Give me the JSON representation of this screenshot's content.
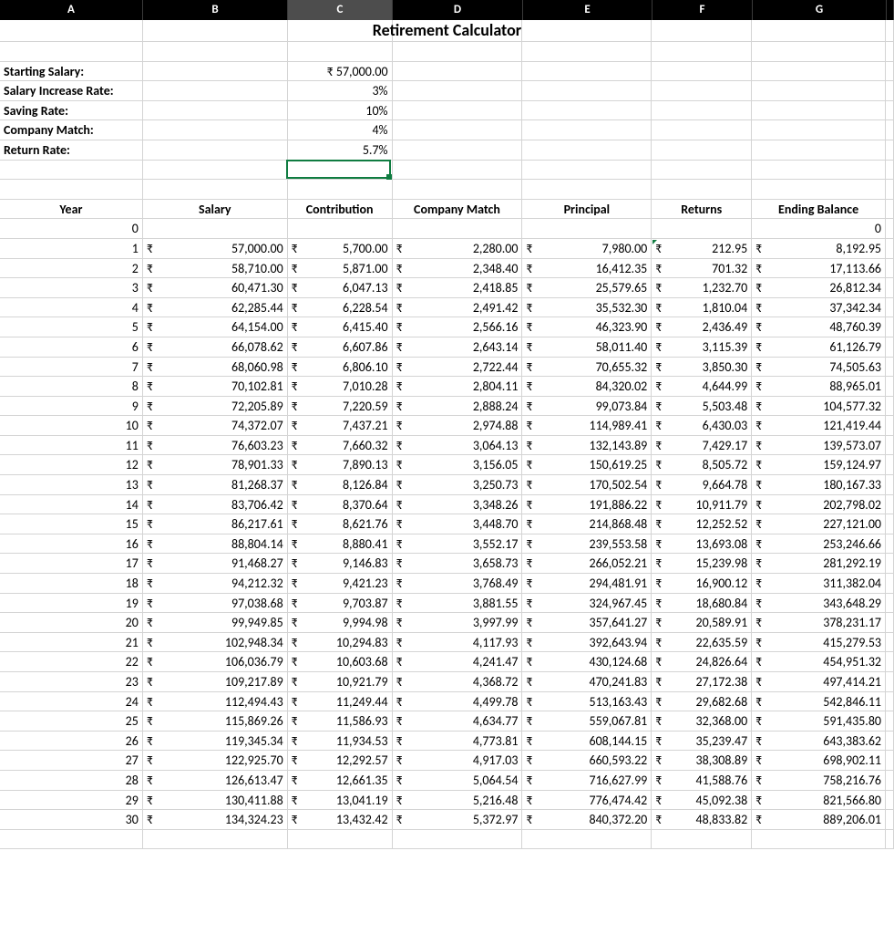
{
  "columns": [
    "A",
    "B",
    "C",
    "D",
    "E",
    "F",
    "G"
  ],
  "selected_column": "C",
  "selected_cell": {
    "row": 7,
    "col": 2
  },
  "title": "Retirement Calculator",
  "currency": "₹",
  "params": [
    {
      "label": "Starting Salary:",
      "value": "₹   57,000.00"
    },
    {
      "label": "Salary Increase Rate:",
      "value": "3%"
    },
    {
      "label": "Saving Rate:",
      "value": "10%"
    },
    {
      "label": "Company Match:",
      "value": "4%"
    },
    {
      "label": "Return Rate:",
      "value": "5.7%"
    }
  ],
  "table_headers": [
    "Year",
    "Salary",
    "Contribution",
    "Company Match",
    "Principal",
    "Returns",
    "Ending Balance"
  ],
  "rows": [
    {
      "year": "0",
      "salary": "",
      "contribution": "",
      "company_match": "",
      "principal": "",
      "returns": "",
      "ending": "0",
      "ending_plain": true
    },
    {
      "year": "1",
      "salary": "57,000.00",
      "contribution": "5,700.00",
      "company_match": "2,280.00",
      "principal": "7,980.00",
      "returns": "212.95",
      "ending": "8,192.95",
      "returns_tri": true
    },
    {
      "year": "2",
      "salary": "58,710.00",
      "contribution": "5,871.00",
      "company_match": "2,348.40",
      "principal": "16,412.35",
      "returns": "701.32",
      "ending": "17,113.66"
    },
    {
      "year": "3",
      "salary": "60,471.30",
      "contribution": "6,047.13",
      "company_match": "2,418.85",
      "principal": "25,579.65",
      "returns": "1,232.70",
      "ending": "26,812.34"
    },
    {
      "year": "4",
      "salary": "62,285.44",
      "contribution": "6,228.54",
      "company_match": "2,491.42",
      "principal": "35,532.30",
      "returns": "1,810.04",
      "ending": "37,342.34"
    },
    {
      "year": "5",
      "salary": "64,154.00",
      "contribution": "6,415.40",
      "company_match": "2,566.16",
      "principal": "46,323.90",
      "returns": "2,436.49",
      "ending": "48,760.39"
    },
    {
      "year": "6",
      "salary": "66,078.62",
      "contribution": "6,607.86",
      "company_match": "2,643.14",
      "principal": "58,011.40",
      "returns": "3,115.39",
      "ending": "61,126.79"
    },
    {
      "year": "7",
      "salary": "68,060.98",
      "contribution": "6,806.10",
      "company_match": "2,722.44",
      "principal": "70,655.32",
      "returns": "3,850.30",
      "ending": "74,505.63"
    },
    {
      "year": "8",
      "salary": "70,102.81",
      "contribution": "7,010.28",
      "company_match": "2,804.11",
      "principal": "84,320.02",
      "returns": "4,644.99",
      "ending": "88,965.01"
    },
    {
      "year": "9",
      "salary": "72,205.89",
      "contribution": "7,220.59",
      "company_match": "2,888.24",
      "principal": "99,073.84",
      "returns": "5,503.48",
      "ending": "104,577.32"
    },
    {
      "year": "10",
      "salary": "74,372.07",
      "contribution": "7,437.21",
      "company_match": "2,974.88",
      "principal": "114,989.41",
      "returns": "6,430.03",
      "ending": "121,419.44"
    },
    {
      "year": "11",
      "salary": "76,603.23",
      "contribution": "7,660.32",
      "company_match": "3,064.13",
      "principal": "132,143.89",
      "returns": "7,429.17",
      "ending": "139,573.07"
    },
    {
      "year": "12",
      "salary": "78,901.33",
      "contribution": "7,890.13",
      "company_match": "3,156.05",
      "principal": "150,619.25",
      "returns": "8,505.72",
      "ending": "159,124.97"
    },
    {
      "year": "13",
      "salary": "81,268.37",
      "contribution": "8,126.84",
      "company_match": "3,250.73",
      "principal": "170,502.54",
      "returns": "9,664.78",
      "ending": "180,167.33"
    },
    {
      "year": "14",
      "salary": "83,706.42",
      "contribution": "8,370.64",
      "company_match": "3,348.26",
      "principal": "191,886.22",
      "returns": "10,911.79",
      "ending": "202,798.02"
    },
    {
      "year": "15",
      "salary": "86,217.61",
      "contribution": "8,621.76",
      "company_match": "3,448.70",
      "principal": "214,868.48",
      "returns": "12,252.52",
      "ending": "227,121.00"
    },
    {
      "year": "16",
      "salary": "88,804.14",
      "contribution": "8,880.41",
      "company_match": "3,552.17",
      "principal": "239,553.58",
      "returns": "13,693.08",
      "ending": "253,246.66"
    },
    {
      "year": "17",
      "salary": "91,468.27",
      "contribution": "9,146.83",
      "company_match": "3,658.73",
      "principal": "266,052.21",
      "returns": "15,239.98",
      "ending": "281,292.19"
    },
    {
      "year": "18",
      "salary": "94,212.32",
      "contribution": "9,421.23",
      "company_match": "3,768.49",
      "principal": "294,481.91",
      "returns": "16,900.12",
      "ending": "311,382.04"
    },
    {
      "year": "19",
      "salary": "97,038.68",
      "contribution": "9,703.87",
      "company_match": "3,881.55",
      "principal": "324,967.45",
      "returns": "18,680.84",
      "ending": "343,648.29"
    },
    {
      "year": "20",
      "salary": "99,949.85",
      "contribution": "9,994.98",
      "company_match": "3,997.99",
      "principal": "357,641.27",
      "returns": "20,589.91",
      "ending": "378,231.17"
    },
    {
      "year": "21",
      "salary": "102,948.34",
      "contribution": "10,294.83",
      "company_match": "4,117.93",
      "principal": "392,643.94",
      "returns": "22,635.59",
      "ending": "415,279.53"
    },
    {
      "year": "22",
      "salary": "106,036.79",
      "contribution": "10,603.68",
      "company_match": "4,241.47",
      "principal": "430,124.68",
      "returns": "24,826.64",
      "ending": "454,951.32"
    },
    {
      "year": "23",
      "salary": "109,217.89",
      "contribution": "10,921.79",
      "company_match": "4,368.72",
      "principal": "470,241.83",
      "returns": "27,172.38",
      "ending": "497,414.21"
    },
    {
      "year": "24",
      "salary": "112,494.43",
      "contribution": "11,249.44",
      "company_match": "4,499.78",
      "principal": "513,163.43",
      "returns": "29,682.68",
      "ending": "542,846.11"
    },
    {
      "year": "25",
      "salary": "115,869.26",
      "contribution": "11,586.93",
      "company_match": "4,634.77",
      "principal": "559,067.81",
      "returns": "32,368.00",
      "ending": "591,435.80"
    },
    {
      "year": "26",
      "salary": "119,345.34",
      "contribution": "11,934.53",
      "company_match": "4,773.81",
      "principal": "608,144.15",
      "returns": "35,239.47",
      "ending": "643,383.62"
    },
    {
      "year": "27",
      "salary": "122,925.70",
      "contribution": "12,292.57",
      "company_match": "4,917.03",
      "principal": "660,593.22",
      "returns": "38,308.89",
      "ending": "698,902.11"
    },
    {
      "year": "28",
      "salary": "126,613.47",
      "contribution": "12,661.35",
      "company_match": "5,064.54",
      "principal": "716,627.99",
      "returns": "41,588.76",
      "ending": "758,216.76"
    },
    {
      "year": "29",
      "salary": "130,411.88",
      "contribution": "13,041.19",
      "company_match": "5,216.48",
      "principal": "776,474.42",
      "returns": "45,092.38",
      "ending": "821,566.80"
    },
    {
      "year": "30",
      "salary": "134,324.23",
      "contribution": "13,432.42",
      "company_match": "5,372.97",
      "principal": "840,372.20",
      "returns": "48,833.82",
      "ending": "889,206.01"
    }
  ]
}
